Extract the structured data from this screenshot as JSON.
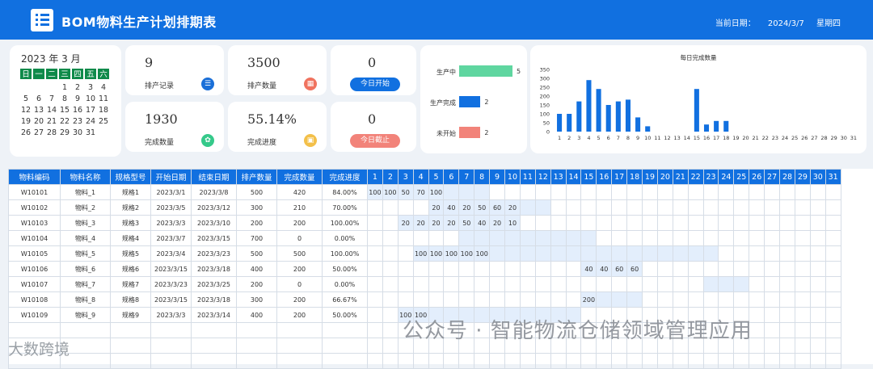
{
  "header": {
    "title": "BOM物料生产计划排期表",
    "date_label": "当前日期：",
    "date_value": "2024/3/7",
    "weekday": "星期四"
  },
  "calendar": {
    "year_month": "2023 年  3 月",
    "weekdays": [
      "日",
      "一",
      "二",
      "三",
      "四",
      "五",
      "六"
    ],
    "days": [
      "",
      "",
      "",
      "1",
      "2",
      "3",
      "4",
      "5",
      "6",
      "7",
      "8",
      "9",
      "10",
      "11",
      "12",
      "13",
      "14",
      "15",
      "16",
      "17",
      "18",
      "19",
      "20",
      "21",
      "22",
      "23",
      "24",
      "25",
      "26",
      "27",
      "28",
      "29",
      "30",
      "31"
    ]
  },
  "stats": {
    "records": {
      "value": "9",
      "label": "排产记录"
    },
    "quantity": {
      "value": "3500",
      "label": "排产数量"
    },
    "start_today": {
      "value": "0",
      "button": "今日开始"
    },
    "completed": {
      "value": "1930",
      "label": "完成数量"
    },
    "progress": {
      "value": "55.14%",
      "label": "完成进度"
    },
    "due_today": {
      "value": "0",
      "button": "今日截止"
    }
  },
  "status": [
    {
      "label": "生产中",
      "value": "5",
      "color": "#5fd6a0"
    },
    {
      "label": "生产完成",
      "value": "2",
      "color": "#1170e0"
    },
    {
      "label": "未开始",
      "value": "2",
      "color": "#f2837a"
    }
  ],
  "chart_data": {
    "type": "bar",
    "title": "每日完成数量",
    "categories": [
      "1",
      "2",
      "3",
      "4",
      "5",
      "6",
      "7",
      "8",
      "9",
      "10",
      "11",
      "12",
      "13",
      "14",
      "15",
      "16",
      "17",
      "18",
      "19",
      "20",
      "21",
      "22",
      "23",
      "24",
      "25",
      "26",
      "27",
      "28",
      "29",
      "30",
      "31"
    ],
    "values": [
      100,
      100,
      170,
      290,
      240,
      150,
      170,
      180,
      80,
      30,
      0,
      0,
      0,
      0,
      240,
      40,
      60,
      60,
      0,
      0,
      0,
      0,
      0,
      0,
      0,
      0,
      0,
      0,
      0,
      0,
      0
    ],
    "y_ticks": [
      "0",
      "50",
      "100",
      "150",
      "200",
      "250",
      "300",
      "350"
    ],
    "ylim": [
      0,
      350
    ],
    "color": "#1170e0"
  },
  "table": {
    "headers": [
      "物料编码",
      "物料名称",
      "规格型号",
      "开始日期",
      "结束日期",
      "排产数量",
      "完成数量",
      "完成进度"
    ],
    "days": [
      "1",
      "2",
      "3",
      "4",
      "5",
      "6",
      "7",
      "8",
      "9",
      "10",
      "11",
      "12",
      "13",
      "14",
      "15",
      "16",
      "17",
      "18",
      "19",
      "20",
      "21",
      "22",
      "23",
      "24",
      "25",
      "26",
      "27",
      "28",
      "29",
      "30",
      "31"
    ],
    "rows": [
      {
        "cells": [
          "W10101",
          "物料_1",
          "规格1",
          "2023/3/1",
          "2023/3/8",
          "500",
          "420",
          "84.00%"
        ],
        "start": 1,
        "end": 8,
        "vals": {
          "1": "100",
          "2": "100",
          "3": "50",
          "4": "70",
          "5": "100"
        }
      },
      {
        "cells": [
          "W10102",
          "物料_2",
          "规格2",
          "2023/3/5",
          "2023/3/12",
          "300",
          "210",
          "70.00%"
        ],
        "start": 5,
        "end": 12,
        "vals": {
          "5": "20",
          "6": "40",
          "7": "20",
          "8": "50",
          "9": "60",
          "10": "20"
        }
      },
      {
        "cells": [
          "W10103",
          "物料_3",
          "规格3",
          "2023/3/3",
          "2023/3/10",
          "200",
          "200",
          "100.00%"
        ],
        "start": 3,
        "end": 10,
        "vals": {
          "3": "20",
          "4": "20",
          "5": "20",
          "6": "20",
          "7": "50",
          "8": "40",
          "9": "20",
          "10": "10"
        }
      },
      {
        "cells": [
          "W10104",
          "物料_4",
          "规格4",
          "2023/3/7",
          "2023/3/15",
          "700",
          "0",
          "0.00%"
        ],
        "start": 7,
        "end": 15,
        "vals": {}
      },
      {
        "cells": [
          "W10105",
          "物料_5",
          "规格5",
          "2023/3/4",
          "2023/3/23",
          "500",
          "500",
          "100.00%"
        ],
        "start": 4,
        "end": 23,
        "vals": {
          "4": "100",
          "5": "100",
          "6": "100",
          "7": "100",
          "8": "100"
        }
      },
      {
        "cells": [
          "W10106",
          "物料_6",
          "规格6",
          "2023/3/15",
          "2023/3/18",
          "400",
          "200",
          "50.00%"
        ],
        "start": 15,
        "end": 18,
        "vals": {
          "15": "40",
          "16": "40",
          "17": "60",
          "18": "60"
        }
      },
      {
        "cells": [
          "W10107",
          "物料_7",
          "规格7",
          "2023/3/23",
          "2023/3/25",
          "200",
          "0",
          "0.00%"
        ],
        "start": 23,
        "end": 25,
        "vals": {}
      },
      {
        "cells": [
          "W10108",
          "物料_8",
          "规格8",
          "2023/3/15",
          "2023/3/18",
          "300",
          "200",
          "66.67%"
        ],
        "start": 15,
        "end": 18,
        "vals": {
          "15": "200"
        }
      },
      {
        "cells": [
          "W10109",
          "物料_9",
          "规格9",
          "2023/3/3",
          "2023/3/14",
          "400",
          "200",
          "50.00%"
        ],
        "start": 3,
        "end": 14,
        "vals": {
          "3": "100",
          "4": "100"
        }
      }
    ],
    "empty_rows": 3
  },
  "watermark": {
    "main": "公众号 · 智能物流仓储领域管理应用",
    "corner": "大数跨境"
  }
}
